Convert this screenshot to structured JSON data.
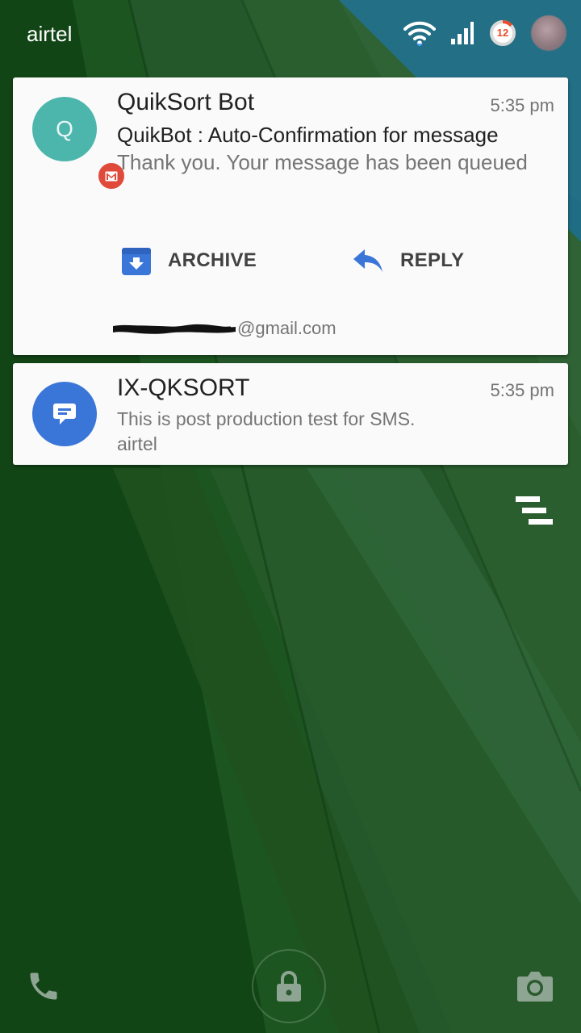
{
  "status_bar": {
    "carrier": "airtel",
    "battery_level": "12",
    "icons": [
      "wifi-icon",
      "cell-signal-icon",
      "battery-ring-icon",
      "user-avatar"
    ]
  },
  "notifications": [
    {
      "app": "gmail",
      "avatar_letter": "Q",
      "avatar_color": "#4db6ac",
      "badge_color": "#e04a3a",
      "title": "QuikSort Bot",
      "time": "5:35 pm",
      "subject": "QuikBot : Auto-Confirmation for message",
      "body": "Thank you. Your message has been queued",
      "actions": [
        {
          "label": "ARCHIVE",
          "icon": "archive-icon"
        },
        {
          "label": "REPLY",
          "icon": "reply-icon"
        }
      ],
      "account_domain": "@gmail.com"
    },
    {
      "app": "messaging",
      "avatar_color": "#3a76d8",
      "title": "IX-QKSORT",
      "time": "5:35 pm",
      "body": "This is post production test for SMS.",
      "subtext": "airtel"
    }
  ],
  "lockscreen": {
    "shortcuts": [
      "phone-icon",
      "lock-icon",
      "camera-icon"
    ],
    "clear_all_icon": "clear-all-icon"
  },
  "colors": {
    "card_background": "#fafafa",
    "accent_blue": "#3a76d8",
    "wallpaper_green": "#1d4a1d",
    "wallpaper_teal": "#1f6d84",
    "wallpaper_ochre": "#8a7b2a"
  }
}
